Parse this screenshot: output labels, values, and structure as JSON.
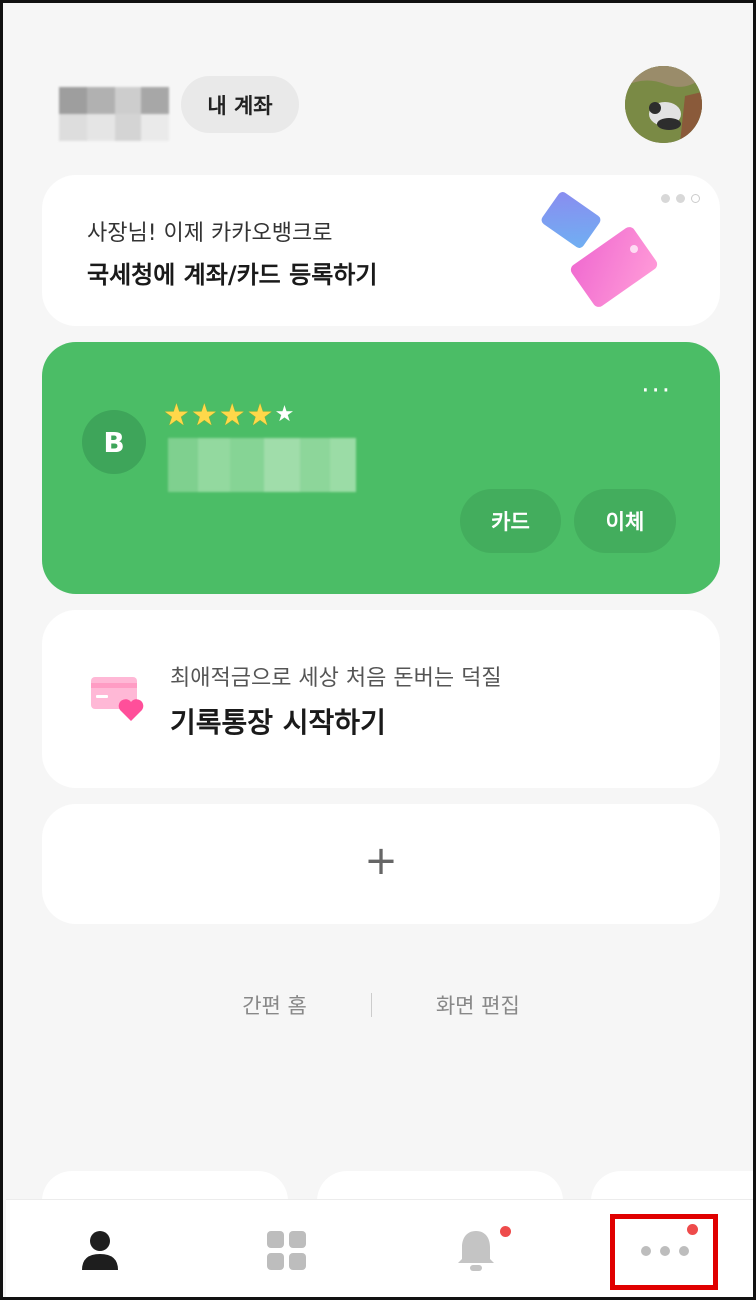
{
  "header": {
    "account_chip_label": "내 계좌",
    "user_name_blurred": true
  },
  "promo_card": {
    "subtitle": "사장님! 이제 카카오뱅크로",
    "title": "국세청에 계좌/카드 등록하기",
    "pager_dots": 3
  },
  "bank_card": {
    "logo_letter": "B",
    "rating_stars": "★★★★",
    "rating_star_small": "★",
    "more_label": "···",
    "card_button": "카드",
    "transfer_button": "이체",
    "color": "#4bbd66"
  },
  "savings_card": {
    "subtitle": "최애적금으로 세상 처음 돈버는 덕질",
    "title": "기록통장 시작하기"
  },
  "add_card": {
    "plus_label": "+"
  },
  "bottom_links": {
    "simple_home": "간편 홈",
    "edit_screen": "화면 편집"
  },
  "nav": {
    "items": [
      {
        "icon": "person-icon"
      },
      {
        "icon": "grid-icon"
      },
      {
        "icon": "bell-icon",
        "badge": true
      },
      {
        "icon": "more-icon",
        "badge": true,
        "highlighted": true
      }
    ]
  }
}
